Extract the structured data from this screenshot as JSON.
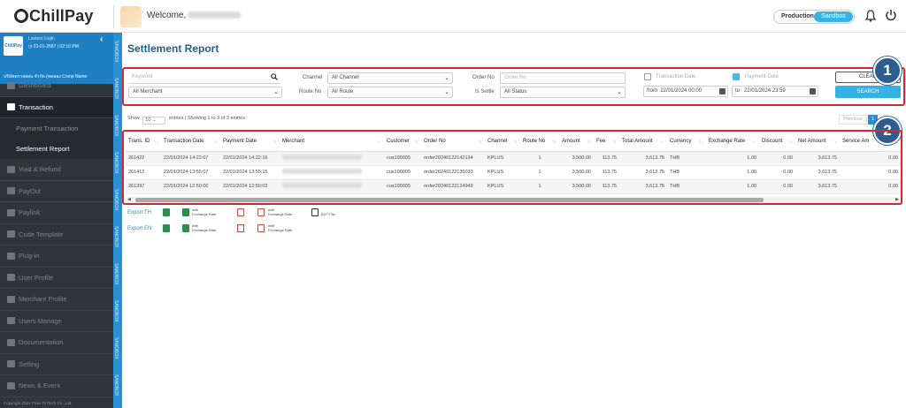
{
  "app": {
    "brand": "ChillPay",
    "welcome": "Welcome,"
  },
  "environment": {
    "production": "Production",
    "sandbox": "Sandbox"
  },
  "sidebar": {
    "logo_text": "ChillPay",
    "last_login_label": "Lastest Login",
    "last_login_value": "23-01-2567 | 02:10 PM",
    "company": "บริษัทตรวจสอบ จำกัด (ทดลอง Comp Name",
    "items": [
      {
        "label": "Dashboard",
        "icon": "chart-icon",
        "active": false
      },
      {
        "label": "Transaction",
        "icon": "document-icon",
        "active": true
      },
      {
        "label": "Void & Refund",
        "icon": "refund-icon",
        "active": false
      },
      {
        "label": "PayOut",
        "icon": "payout-icon",
        "active": false
      },
      {
        "label": "Paylink",
        "icon": "link-icon",
        "active": false
      },
      {
        "label": "Code Template",
        "icon": "code-icon",
        "active": false
      },
      {
        "label": "Plug-in",
        "icon": "plugin-icon",
        "active": false
      },
      {
        "label": "User Profile",
        "icon": "user-icon",
        "active": false
      },
      {
        "label": "Merchant Profile",
        "icon": "users-icon",
        "active": false
      },
      {
        "label": "Users Manage",
        "icon": "users-manage-icon",
        "active": false
      },
      {
        "label": "Documentation",
        "icon": "folder-icon",
        "active": false
      },
      {
        "label": "Setting",
        "icon": "gear-icon",
        "active": false
      },
      {
        "label": "News & Event",
        "icon": "news-icon",
        "active": false
      }
    ],
    "sub_items": [
      {
        "label": "Payment Transaction"
      },
      {
        "label": "Settlement Report"
      }
    ],
    "footer": "Copyright 2024 Prain FinTech Co., Ltd.",
    "strip_label": "SANDBOX"
  },
  "page": {
    "title": "Settlement Report"
  },
  "filters": {
    "keyword_placeholder": "Keyword",
    "merchant_value": "All Merchant",
    "channel_label": "Channel",
    "channel_value": "All Channel",
    "route_label": "Route No",
    "route_value": "All Route",
    "order_label": "Order No",
    "order_placeholder": "Order No",
    "settle_label": "Is Settle",
    "settle_value": "All Status",
    "transaction_date_label": "Transaction Date",
    "transaction_date_checked": false,
    "payment_date_label": "Payment Date",
    "payment_date_checked": true,
    "from_label": "from",
    "from_value": "22/01/2024 00:00",
    "to_label": "to",
    "to_value": "22/01/2024 23:59",
    "clear_label": "CLEAR",
    "search_label": "SEARCH"
  },
  "badges": {
    "one": "1",
    "two": "2"
  },
  "listing": {
    "show_label": "Show",
    "page_size": "10",
    "entries_label": "entries",
    "showing_text": "Showing 1 to 3 of 3 entries",
    "previous_label": "Previous",
    "current_page": "1"
  },
  "table": {
    "columns": [
      "Trans. ID",
      "Transaction Date",
      "Payment Date",
      "Merchant",
      "Customer",
      "Order No",
      "Channel",
      "Route No",
      "Amount",
      "Fee",
      "Total Amount",
      "Currency",
      "Exchange Rate",
      "Discount",
      "Net Amount",
      "Service Am"
    ],
    "rows": [
      {
        "id": "261422",
        "tdate": "22/01/2024 14:22:07",
        "pdate": "22/01/2024 14:22:16",
        "customer": "cus100005",
        "order": "order20240122142134",
        "channel": "KPLUS",
        "route": "1",
        "amount": "3,500.00",
        "fee": "113.75",
        "total": "3,613.75",
        "currency": "THB",
        "rate": "1.00",
        "discount": "0.00",
        "net": "3,613.75",
        "service": "0.00"
      },
      {
        "id": "261412",
        "tdate": "22/01/2024 13:55:07",
        "pdate": "22/01/2024 13:55:15",
        "customer": "cus100005",
        "order": "order20240122135033",
        "channel": "KPLUS",
        "route": "1",
        "amount": "3,500.00",
        "fee": "113.75",
        "total": "3,613.75",
        "currency": "THB",
        "rate": "1.00",
        "discount": "0.00",
        "net": "3,613.75",
        "service": "0.00"
      },
      {
        "id": "261397",
        "tdate": "22/01/2024 12:50:00",
        "pdate": "22/01/2024 12:50:03",
        "customer": "cus100005",
        "order": "order20240122124949",
        "channel": "KPLUS",
        "route": "1",
        "amount": "3,500.00",
        "fee": "113.75",
        "total": "3,613.75",
        "currency": "THB",
        "rate": "1.00",
        "discount": "0.00",
        "net": "3,613.75",
        "service": "0.00"
      }
    ]
  },
  "exports": {
    "th_label": "Export TH",
    "en_label": "Export EN",
    "with_exchange": "with Exchange Rate",
    "with_label": "with",
    "exchange_rate_label": "Exchange Rate",
    "bot_file": "BOT File"
  },
  "colors": {
    "accent": "#2a8fd0",
    "sidebar_bg": "#2f353b",
    "highlight_border": "#d9252d",
    "badge": "#2d5c91"
  }
}
